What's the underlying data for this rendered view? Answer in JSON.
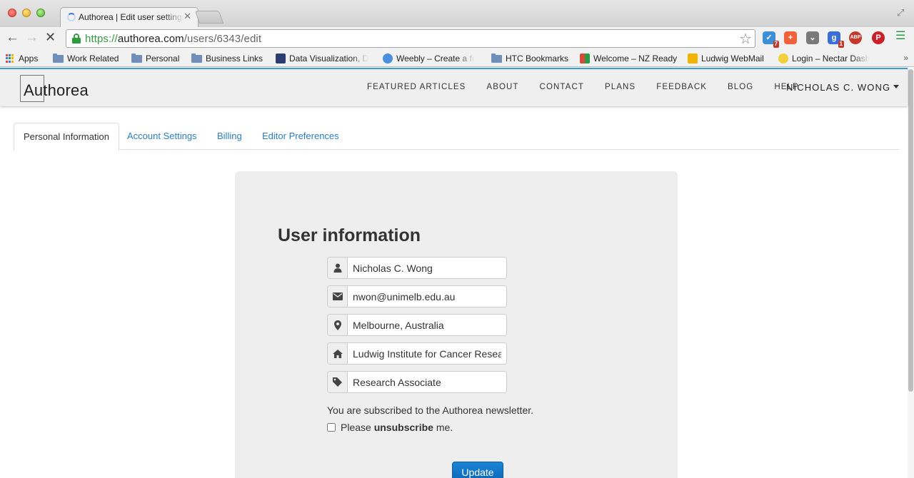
{
  "browser": {
    "tab_title": "Authorea | Edit user settings",
    "url_protocol": "https://",
    "url_host": "authorea.com",
    "url_path": "/users/6343/edit",
    "extensions": [
      {
        "icon": "todo-check-icon",
        "color": "#3d8fd6",
        "badge": "7"
      },
      {
        "icon": "plus-icon",
        "color": "#f0623c",
        "badge": ""
      },
      {
        "icon": "pocket-icon",
        "color": "#7a7a7a",
        "badge": ""
      },
      {
        "icon": "google-plus-icon",
        "color": "#3b6fd8",
        "badge": "1"
      },
      {
        "icon": "adblock-plus-icon",
        "color": "#c5392b",
        "badge": ""
      },
      {
        "icon": "pinterest-icon",
        "color": "#cb2027",
        "badge": ""
      }
    ],
    "bookmarks": [
      {
        "label": "Apps"
      },
      {
        "label": "Work Related"
      },
      {
        "label": "Personal"
      },
      {
        "label": "Business Links"
      },
      {
        "label": "Data Visualization, D"
      },
      {
        "label": "Weebly – Create a fr"
      },
      {
        "label": "HTC Bookmarks"
      },
      {
        "label": "Welcome – NZ Ready"
      },
      {
        "label": "Ludwig WebMail"
      },
      {
        "label": "Login – Nectar Dash"
      }
    ],
    "bookmarks_more": "»"
  },
  "site": {
    "logo_text": "Authorea",
    "nav": [
      "FEATURED ARTICLES",
      "ABOUT",
      "CONTACT",
      "PLANS",
      "FEEDBACK",
      "BLOG",
      "HELP"
    ],
    "user_name": "NICHOLAS C. WONG",
    "accent_color": "#3a9ad9"
  },
  "tabs": [
    "Personal Information",
    "Account Settings",
    "Billing",
    "Editor Preferences"
  ],
  "form": {
    "title": "User information",
    "name": "Nicholas C. Wong",
    "email": "nwon@unimelb.edu.au",
    "location": "Melbourne, Australia",
    "institution": "Ludwig Institute for Cancer Research",
    "title_field": "Research Associate",
    "newsletter_text": "You are subscribed to the Authorea newsletter.",
    "unsubscribe_pre": "Please",
    "unsubscribe_bold": "unsubscribe",
    "unsubscribe_post": "me.",
    "update_label": "Update"
  }
}
